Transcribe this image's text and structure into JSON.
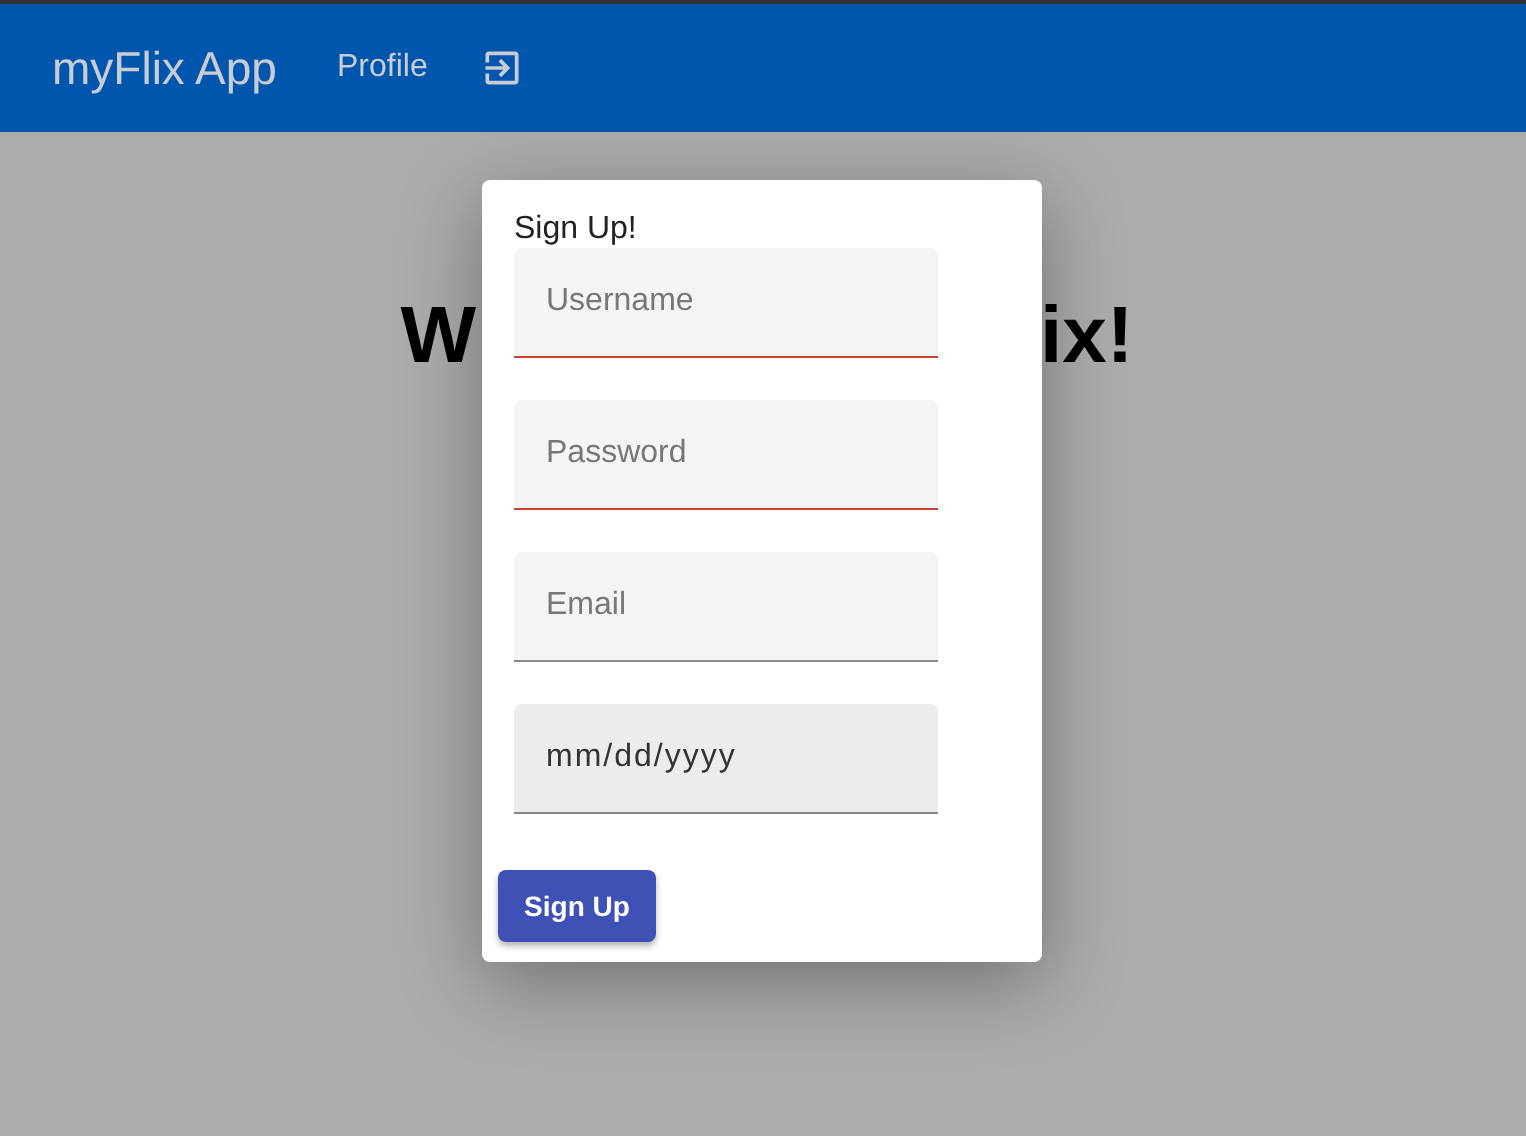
{
  "navbar": {
    "brand": "myFlix App",
    "links": [
      {
        "label": "Profile",
        "kind": "text"
      },
      {
        "kind": "logout"
      }
    ]
  },
  "heading": {
    "visible_parts": [
      "W",
      "ix!"
    ]
  },
  "dialog": {
    "title": "Sign Up!",
    "fields": [
      {
        "kind": "text",
        "placeholder": "Username",
        "invalid": true
      },
      {
        "kind": "text",
        "placeholder": "Password",
        "invalid": true
      },
      {
        "kind": "text",
        "placeholder": "Email",
        "invalid": false
      },
      {
        "kind": "date",
        "value": "mm/dd/yyyy",
        "invalid": false
      }
    ],
    "button": "Sign Up"
  }
}
